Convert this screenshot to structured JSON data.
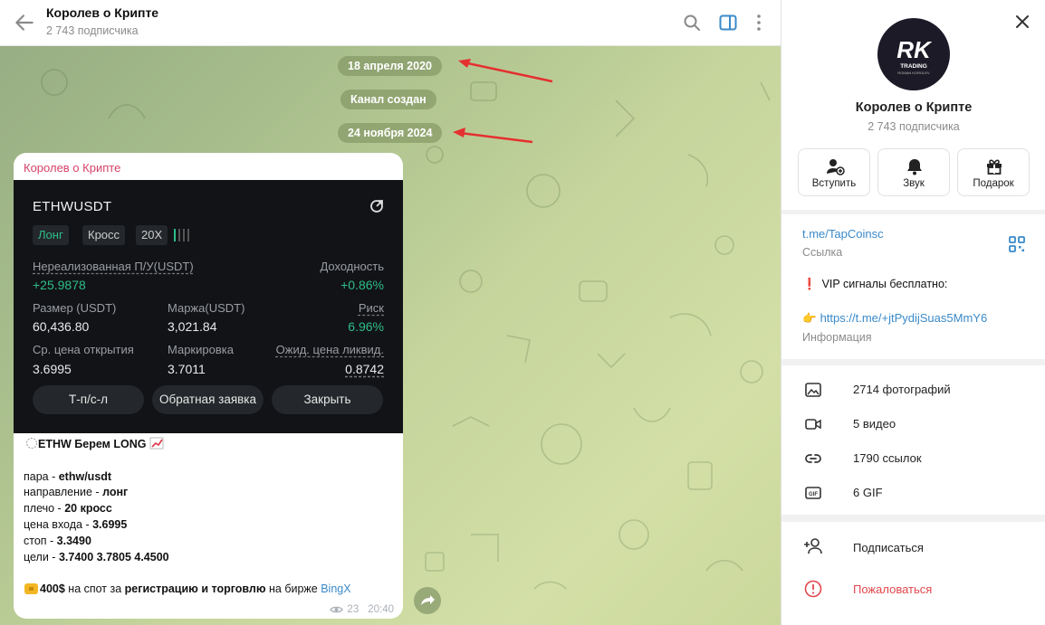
{
  "header": {
    "title": "Королев о Крипте",
    "subscribers": "2 743 подписчика"
  },
  "chat": {
    "date_pills": [
      "18 апреля 2020",
      "Канал создан",
      "24 ноября 2024"
    ]
  },
  "message": {
    "sender": "Королев о Крипте",
    "card": {
      "symbol": "ETHWUSDT",
      "tags": [
        "Лонг",
        "Кросс",
        "20X"
      ],
      "unrealized_label": "Нереализованная П/У(USDT)",
      "unrealized_value": "+25.9878",
      "yield_label": "Доходность",
      "yield_value": "+0.86%",
      "size_label": "Размер (USDT)",
      "size_value": "60,436.80",
      "margin_label": "Маржа(USDT)",
      "margin_value": "3,021.84",
      "risk_label": "Риск",
      "risk_value": "6.96%",
      "open_label": "Ср. цена открытия",
      "open_value": "3.6995",
      "mark_label": "Маркировка",
      "mark_value": "3.7011",
      "liq_label": "Ожид. цена ликвид.",
      "liq_value": "0.8742",
      "buttons": [
        "Т-п/с-л",
        "Обратная заявка",
        "Закрыть"
      ]
    },
    "text": {
      "headline": "ETHW Берем LONG",
      "pair_label": "пара - ",
      "pair_value": "ethw/usdt",
      "dir_label": "направление - ",
      "dir_value": "лонг",
      "lev_label": "плечо - ",
      "lev_value": "20 кросс",
      "entry_label": "цена входа - ",
      "entry_value": "3.6995",
      "stop_label": "стоп - ",
      "stop_value": "3.3490",
      "targets_label": "цели - ",
      "targets_value": "3.7400 3.7805 4.4500",
      "promo_amount": "400$",
      "promo_mid": " на спот за ",
      "promo_bold": "регистрацию и торговлю",
      "promo_end": " на бирже ",
      "promo_link": "BingX"
    },
    "views": "23",
    "time": "20:40"
  },
  "panel": {
    "avatar_logo": "RK",
    "avatar_line1": "TRADING",
    "avatar_line2": "ROMAN KOROLEV",
    "name": "Королев о Крипте",
    "subscribers": "2 743 подписчика",
    "actions": [
      "Вступить",
      "Звук",
      "Подарок"
    ],
    "link": "t.me/TapCoinsc",
    "link_caption": "Ссылка",
    "vip_text": "VIP сигналы бесплатно:",
    "info_link": "https://t.me/+jtPydijSuas5MmY6",
    "info_caption": "Информация",
    "media": [
      "2714 фотографий",
      "5 видео",
      "1790 ссылок",
      "6 GIF"
    ],
    "subscribe": "Подписаться",
    "report": "Пожаловаться"
  },
  "colors": {
    "accent": "#3a8ac9",
    "sender": "#d6426c",
    "positive": "#2fbd88",
    "danger": "#e2474d"
  }
}
